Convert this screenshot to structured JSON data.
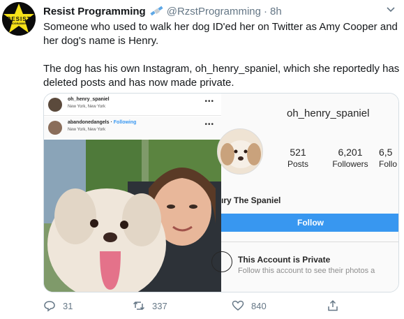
{
  "tweet": {
    "author_name": "Resist Programming",
    "handle": "@RzstProgramming",
    "separator": "·",
    "time": "8h",
    "avatar_text": "RESIST",
    "avatar_subtext": "PROGRAMMING",
    "body_line1": "Someone who used to walk her dog ID'ed her on Twitter as Amy Cooper and her dog's name is Henry.",
    "body_line2": "The dog has his own Instagram, oh_henry_spaniel, which she reportedly has deleted posts and has now made private."
  },
  "media": {
    "post1_user": "oh_henry_spaniel",
    "post1_location": "New York, New York",
    "post2_user": "abandonedangels",
    "post2_separator": "·",
    "post2_follow": "Following",
    "post2_location": "New York, New York",
    "more_dots": "•••",
    "profile": {
      "username": "oh_henry_spaniel",
      "posts_count": "521",
      "posts_label": "Posts",
      "followers_count": "6,201",
      "followers_label": "Followers",
      "following_count": "6,5",
      "following_label": "Follo",
      "display_name": "ıry The Spaniel",
      "follow_button": "Follow",
      "private_title": "This Account is Private",
      "private_sub": "Follow this account to see their photos a"
    }
  },
  "actions": {
    "replies": "31",
    "retweets": "337",
    "likes": "840"
  },
  "colors": {
    "accent": "#1da1f2",
    "muted": "#657786",
    "instagram_blue": "#3897f0",
    "avatar_yellow": "#f5e11a"
  }
}
